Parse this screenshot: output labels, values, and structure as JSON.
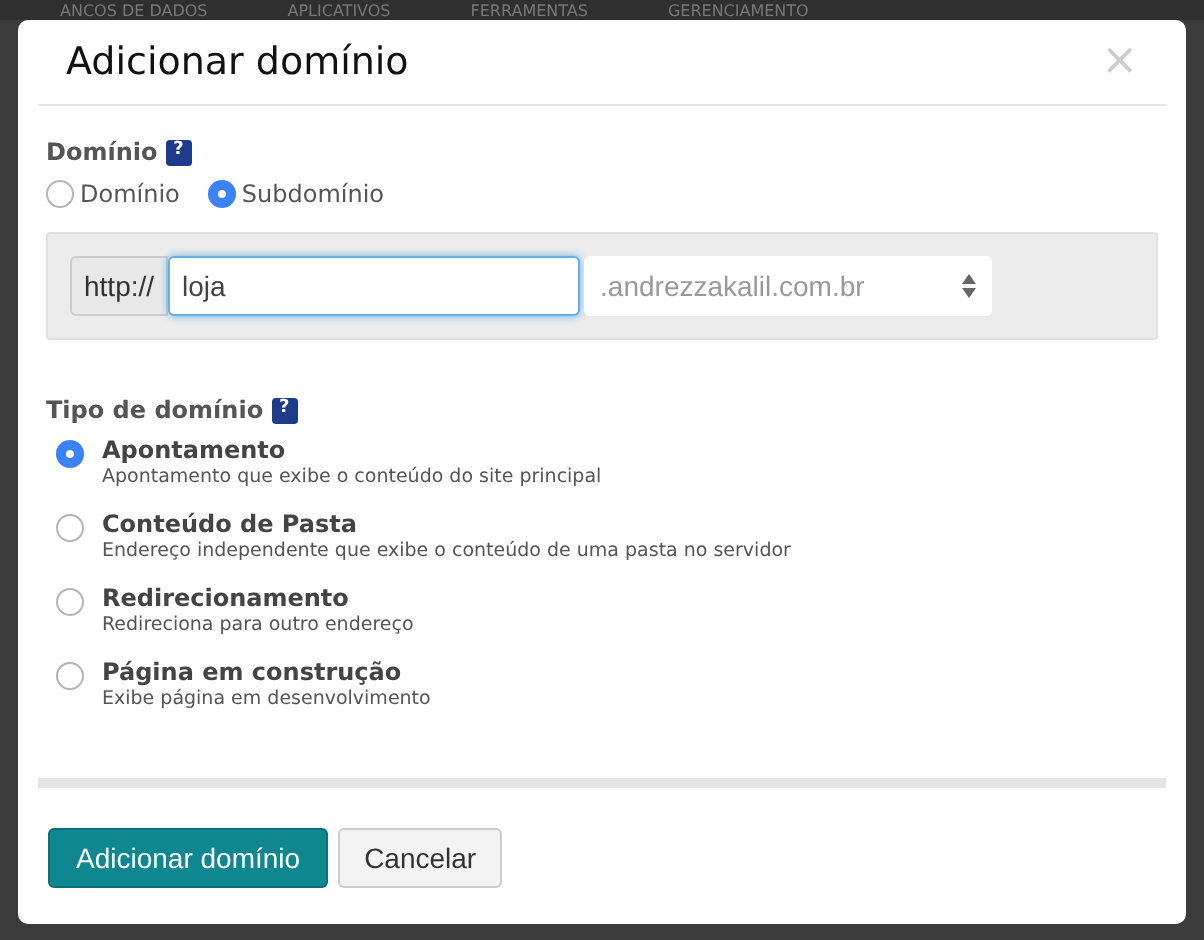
{
  "background_nav": [
    "ANCOS DE DADOS",
    "APLICATIVOS",
    "FERRAMENTAS",
    "GERENCIAMENTO"
  ],
  "dialog": {
    "title": "Adicionar domínio",
    "close": "×"
  },
  "domain": {
    "label": "Domínio",
    "help": "?",
    "options": [
      {
        "label": "Domínio",
        "selected": false
      },
      {
        "label": "Subdomínio",
        "selected": true
      }
    ],
    "prefix": "http://",
    "value": "loja",
    "suffix": ".andrezzakalil.com.br"
  },
  "domain_type": {
    "label": "Tipo de domínio",
    "help": "?",
    "options": [
      {
        "title": "Apontamento",
        "description": "Apontamento que exibe o conteúdo do site principal",
        "selected": true
      },
      {
        "title": "Conteúdo de Pasta",
        "description": "Endereço independente que exibe o conteúdo de uma pasta no servidor",
        "selected": false
      },
      {
        "title": "Redirecionamento",
        "description": "Redireciona para outro endereço",
        "selected": false
      },
      {
        "title": "Página em construção",
        "description": "Exibe página em desenvolvimento",
        "selected": false
      }
    ]
  },
  "buttons": [
    {
      "label": "Adicionar domínio",
      "kind": "primary"
    },
    {
      "label": "Cancelar",
      "kind": "secondary"
    }
  ]
}
